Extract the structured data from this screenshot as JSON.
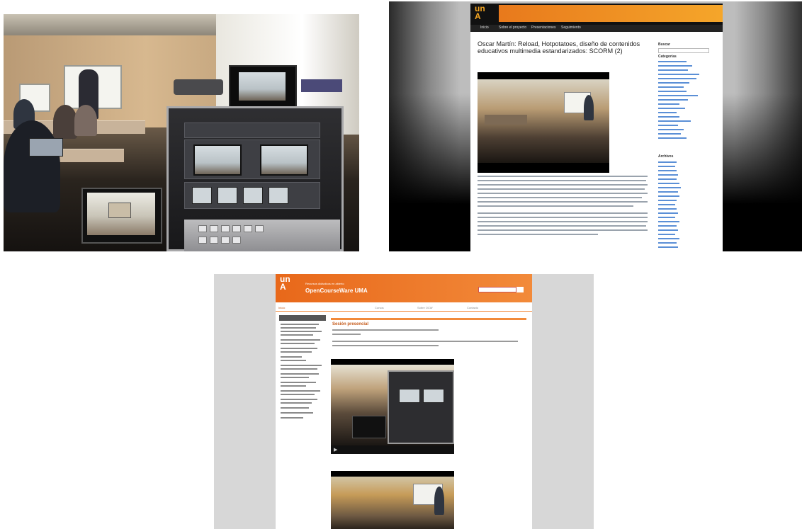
{
  "blog": {
    "logo_text": "un\nA",
    "nav": [
      "Inicio",
      "Sobre el proyecto",
      "Presentaciones",
      "Seguimiento"
    ],
    "post_title": "Oscar Martín: Reload, Hotpotatoes, diseño de contenidos educativos multimedia estandarizados: SCORM (2)",
    "sidebar_search": "Buscar",
    "sidebar_categories": "Categorías",
    "sidebar_archives": "Archivos"
  },
  "ocw": {
    "logo_text": "un\nA",
    "subtitle": "Recursos didácticos en abierto",
    "brand": "OpenCourseWare UMA",
    "tabs": [
      "Inicio",
      "Cursos",
      "Sobre OCW",
      "Contacto"
    ],
    "page_title": "Sesión presencial"
  },
  "colors": {
    "orange": "#f28a3a",
    "blog_orange": "#e8791c",
    "dark": "#111111"
  }
}
